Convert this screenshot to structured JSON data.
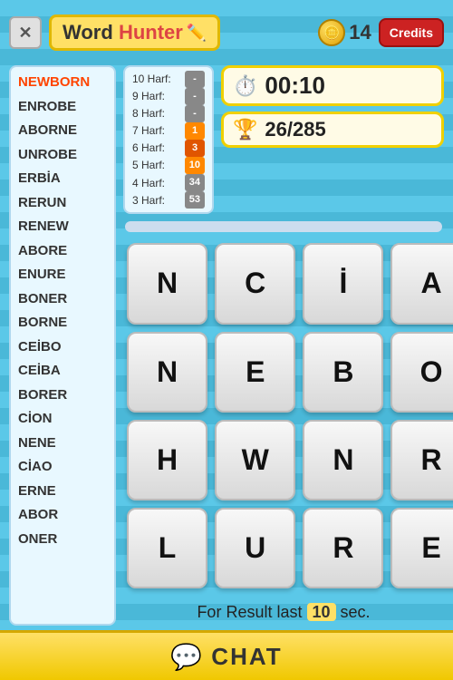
{
  "app": {
    "title_word": "Word",
    "title_hunter": "Hunter",
    "coin_count": "14",
    "credits_label": "Credits"
  },
  "harf": {
    "rows": [
      {
        "label": "10 Harf:",
        "value": "-",
        "badge_type": "neutral"
      },
      {
        "label": "9 Harf:",
        "value": "-",
        "badge_type": "neutral"
      },
      {
        "label": "8 Harf:",
        "value": "-",
        "badge_type": "neutral"
      },
      {
        "label": "7 Harf:",
        "value": "1",
        "badge_type": "orange"
      },
      {
        "label": "6 Harf:",
        "value": "3",
        "badge_type": "dark-orange"
      },
      {
        "label": "5 Harf:",
        "value": "10",
        "badge_type": "orange"
      },
      {
        "label": "4 Harf:",
        "value": "34",
        "badge_type": "neutral"
      },
      {
        "label": "3 Harf:",
        "value": "53",
        "badge_type": "neutral"
      }
    ]
  },
  "timer": {
    "display": "00:10"
  },
  "score": {
    "display": "26/285"
  },
  "grid": {
    "letters": [
      "N",
      "C",
      "İ",
      "A",
      "N",
      "E",
      "B",
      "O",
      "H",
      "W",
      "N",
      "R",
      "L",
      "U",
      "R",
      "E"
    ]
  },
  "result": {
    "prefix": "For Result last",
    "highlight": "10",
    "suffix": "sec."
  },
  "word_list": {
    "words": [
      {
        "text": "NEWBORN",
        "highlight": true
      },
      {
        "text": "ENROBE",
        "highlight": false
      },
      {
        "text": "ABORNE",
        "highlight": false
      },
      {
        "text": "UNROBE",
        "highlight": false
      },
      {
        "text": "ERBİA",
        "highlight": false
      },
      {
        "text": "RERUN",
        "highlight": false
      },
      {
        "text": "RENEW",
        "highlight": false
      },
      {
        "text": "ABORE",
        "highlight": false
      },
      {
        "text": "ENURE",
        "highlight": false
      },
      {
        "text": "BONER",
        "highlight": false
      },
      {
        "text": "BORNE",
        "highlight": false
      },
      {
        "text": "CEİBO",
        "highlight": false
      },
      {
        "text": "CEİBA",
        "highlight": false
      },
      {
        "text": "BORER",
        "highlight": false
      },
      {
        "text": "CİON",
        "highlight": false
      },
      {
        "text": "NENE",
        "highlight": false
      },
      {
        "text": "CİAO",
        "highlight": false
      },
      {
        "text": "ERNE",
        "highlight": false
      },
      {
        "text": "ABOR",
        "highlight": false
      },
      {
        "text": "ONER",
        "highlight": false
      }
    ]
  },
  "chat": {
    "label": "CHAT"
  }
}
